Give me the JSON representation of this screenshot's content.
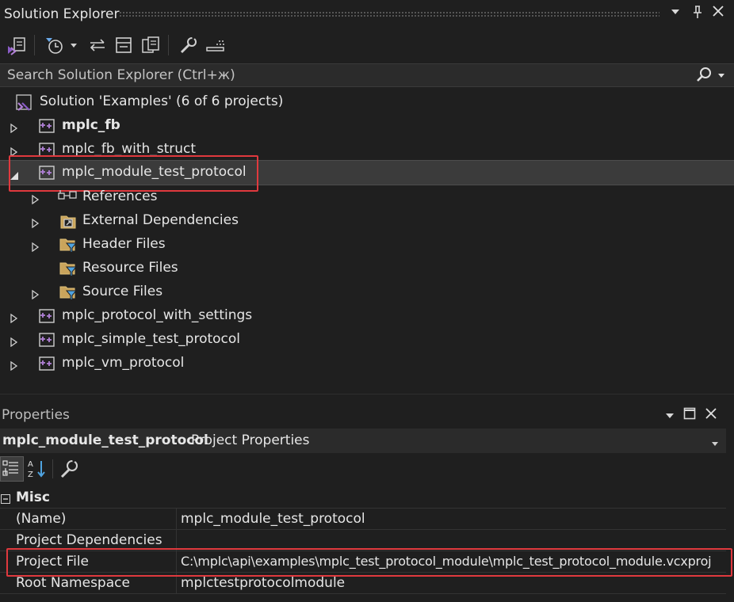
{
  "solution_explorer": {
    "title": "Solution Explorer",
    "header_buttons": [
      "dropdown",
      "pin",
      "close"
    ],
    "search_placeholder": "Search Solution Explorer (Ctrl+ж)",
    "solution_label": "Solution 'Examples' (6 of 6 projects)",
    "tree": [
      {
        "label": "mplc_fb",
        "bold": true,
        "expanded": false
      },
      {
        "label": "mplc_fb_with_struct",
        "expanded": false
      },
      {
        "label": "mplc_module_test_protocol",
        "expanded": true,
        "selected": true,
        "children": [
          {
            "label": "References"
          },
          {
            "label": "External Dependencies"
          },
          {
            "label": "Header Files"
          },
          {
            "label": "Resource Files"
          },
          {
            "label": "Source Files"
          }
        ]
      },
      {
        "label": "mplc_protocol_with_settings",
        "expanded": false
      },
      {
        "label": "mplc_simple_test_protocol",
        "expanded": false
      },
      {
        "label": "mplc_vm_protocol",
        "expanded": false
      }
    ]
  },
  "properties": {
    "title": "Properties",
    "object_name": "mplc_module_test_protocol",
    "object_type": "Project Properties",
    "category": "Misc",
    "rows": [
      {
        "key": "(Name)",
        "value": "mplc_module_test_protocol"
      },
      {
        "key": "Project Dependencies",
        "value": ""
      },
      {
        "key": "Project File",
        "value": "C:\\mplc\\api\\examples\\mplc_test_protocol_module\\mplc_test_protocol_module.vcxproj"
      },
      {
        "key": "Root Namespace",
        "value": "mplctestprotocolmodule"
      }
    ]
  },
  "colors": {
    "accent": "#b180d7",
    "highlight": "#e0393e",
    "background": "#1f1f1f"
  }
}
